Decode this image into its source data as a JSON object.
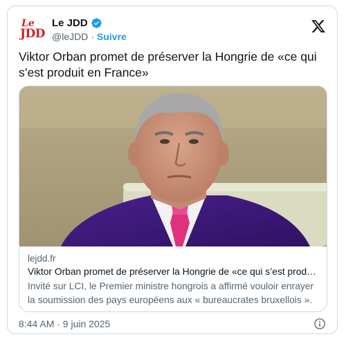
{
  "account": {
    "logo_line1": "Le",
    "logo_line2": "JDD",
    "display_name": "Le JDD",
    "handle": "@leJDD",
    "separator": "·",
    "follow_label": "Suivre"
  },
  "post": {
    "text": "Viktor Orban promet de préserver la Hongrie de «ce qui s’est produit en France»",
    "timestamp": "8:44 AM · 9 juin 2025"
  },
  "link_preview": {
    "domain": "lejdd.fr",
    "title": "Viktor Orban promet de préserver la Hongrie de «ce qui s’est produi…",
    "description": "Invité sur LCI, le Premier ministre hongrois a affirmé vouloir enrayer la soumission des pays européens aux « bureaucrates bruxellois ». ..."
  },
  "colors": {
    "accent": "#1d9bf0",
    "logo_red": "#d51f26",
    "secondary_text": "#536471",
    "border": "#cfd9de"
  },
  "icons": [
    "jdd-logo",
    "verified-badge-icon",
    "x-logo-icon",
    "info-icon"
  ]
}
